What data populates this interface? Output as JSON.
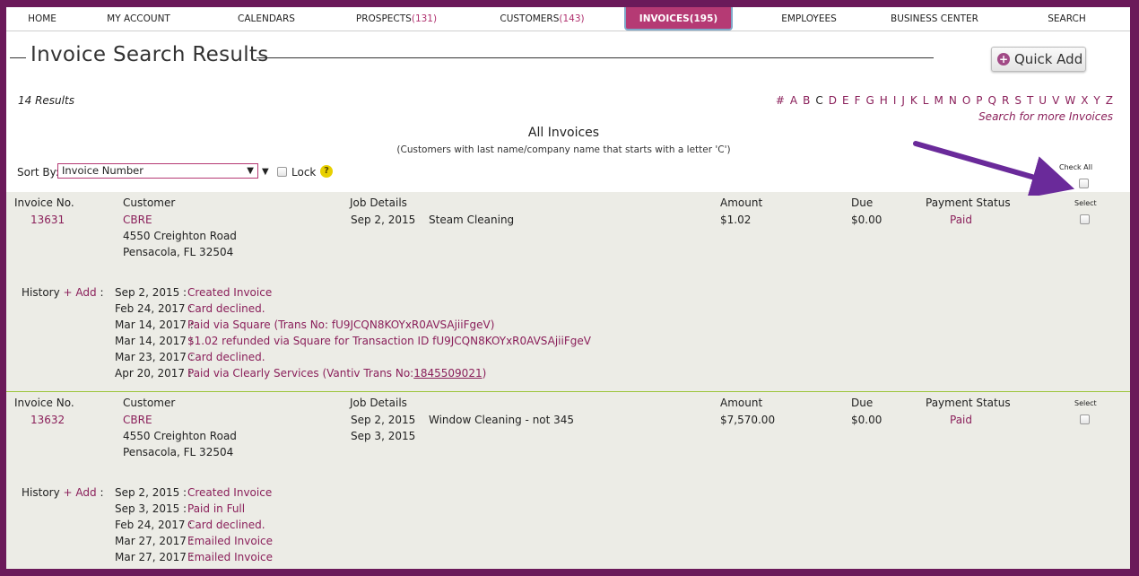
{
  "nav": {
    "home": "HOME",
    "my_account": "MY ACCOUNT",
    "calendars": "CALENDARS",
    "prospects": "PROSPECTS",
    "prospects_count": "(131)",
    "customers": "CUSTOMERS",
    "customers_count": "(143)",
    "invoices": "INVOICES",
    "invoices_count": "(195)",
    "employees": "EMPLOYEES",
    "business_center": "BUSINESS CENTER",
    "search": "SEARCH"
  },
  "page": {
    "title": "Invoice Search Results",
    "quick_add": "Quick Add",
    "results_count": "14 Results",
    "search_more": "Search for more Invoices",
    "list_title": "All Invoices",
    "list_subtitle": "(Customers with last name/company name that starts with a letter 'C')",
    "sort_label": "Sort By:",
    "sort_value": "Invoice Number",
    "lock_label": "Lock",
    "check_all": "Check All"
  },
  "alphabet": [
    "#",
    "A",
    "B",
    "C",
    "D",
    "E",
    "F",
    "G",
    "H",
    "I",
    "J",
    "K",
    "L",
    "M",
    "N",
    "O",
    "P",
    "Q",
    "R",
    "S",
    "T",
    "U",
    "V",
    "W",
    "X",
    "Y",
    "Z"
  ],
  "alphabet_current": "C",
  "headers": {
    "invoice_no": "Invoice No.",
    "customer": "Customer",
    "job_details": "Job Details",
    "amount": "Amount",
    "due": "Due",
    "payment_status": "Payment Status",
    "select": "Select",
    "history": "History",
    "add": "+ Add",
    "colon": ":"
  },
  "invoices": [
    {
      "number": "13631",
      "customer_name": "CBRE",
      "address1": "4550 Creighton Road",
      "address2": "Pensacola, FL 32504",
      "job_dates": [
        "Sep 2, 2015"
      ],
      "job_desc": "Steam Cleaning",
      "amount": "$1.02",
      "due": "$0.00",
      "status": "Paid",
      "history": [
        {
          "date": "Sep 2, 2015 :",
          "text": "Created Invoice"
        },
        {
          "date": "Feb 24, 2017 :",
          "text": "Card declined."
        },
        {
          "date": "Mar 14, 2017 :",
          "text": "Paid via Square (Trans No: fU9JCQN8KOYxR0AVSAjiiFgeV)"
        },
        {
          "date": "Mar 14, 2017 :",
          "text": "$1.02 refunded via Square for Transaction ID fU9JCQN8KOYxR0AVSAjiiFgeV"
        },
        {
          "date": "Mar 23, 2017 :",
          "text": "Card declined."
        },
        {
          "date": "Apr 20, 2017 :",
          "text": "Paid via Clearly Services (Vantiv Trans No:",
          "link": "1845509021",
          "tail": ")"
        }
      ]
    },
    {
      "number": "13632",
      "customer_name": "CBRE",
      "address1": "4550 Creighton Road",
      "address2": "Pensacola, FL 32504",
      "job_dates": [
        "Sep 2, 2015",
        "Sep 3, 2015"
      ],
      "job_desc": "Window Cleaning - not 345",
      "amount": "$7,570.00",
      "due": "$0.00",
      "status": "Paid",
      "history": [
        {
          "date": "Sep 2, 2015 :",
          "text": "Created Invoice"
        },
        {
          "date": "Sep 3, 2015 :",
          "text": "Paid in Full"
        },
        {
          "date": "Feb 24, 2017 :",
          "text": "Card declined."
        },
        {
          "date": "Mar 27, 2017 :",
          "text": "Emailed Invoice"
        },
        {
          "date": "Mar 27, 2017 :",
          "text": "Emailed Invoice"
        }
      ]
    }
  ],
  "colors": {
    "frame": "#6b1a5a",
    "accent": "#b53a74",
    "link": "#8a1f5a",
    "row_bg": "#ecece6",
    "divider": "#9cc43a",
    "arrow": "#6a2a9a"
  }
}
